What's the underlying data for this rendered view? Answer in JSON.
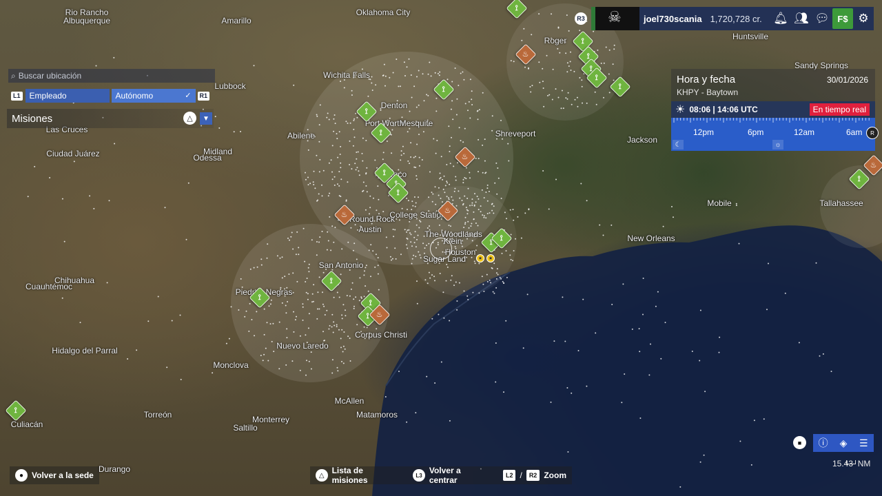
{
  "topbar": {
    "r3_badge": "R3",
    "username": "joel730scania",
    "credits": "1,720,728 cr.",
    "icons": [
      "bell-icon",
      "friends-icon",
      "chat-icon",
      "shop-icon",
      "gear-icon"
    ],
    "shop_label": "F$"
  },
  "search": {
    "placeholder": "Buscar ubicación"
  },
  "mode_tabs": {
    "left_badge": "L1",
    "right_badge": "R1",
    "employee": "Empleado",
    "freelance": "Autónomo",
    "selected": "Autónomo"
  },
  "missions": {
    "title": "Misiones"
  },
  "time_panel": {
    "title": "Hora y fecha",
    "date": "30/01/2026",
    "station": "KHPY - Baytown",
    "clock": "08:06 | 14:06 UTC",
    "realtime": "En tiempo real",
    "timeline_labels": [
      "12pm",
      "6pm",
      "12am",
      "6am"
    ],
    "r_badge": "R"
  },
  "cities": [
    "Rio Rancho",
    "Albuquerque",
    "Amarillo",
    "Oklahoma City",
    "Huntsville",
    "Sandy Springs",
    "Lubbock",
    "Wichita Falls",
    "Denton",
    "Fort Worth",
    "Mesquite",
    "Abilene",
    "Shreveport",
    "Jackson",
    "Las Cruces",
    "Ciudad Juárez",
    "Midland",
    "Odessa",
    "Waco",
    "Mobile",
    "Tallahassee",
    "Round Rock",
    "Austin",
    "College Station",
    "The Woodlands",
    "Klein",
    "Houston",
    "Sugar Land",
    "New Orleans",
    "San Antonio",
    "Chihuahua",
    "Cuauhtémoc",
    "Piedras Negras",
    "Corpus Christi",
    "Nuevo Laredo",
    "Hidalgo del Parral",
    "Monclova",
    "McAllen",
    "Culiacán",
    "Torreón",
    "Monterrey",
    "Matamoros",
    "Saltillo",
    "Durango",
    "Roger"
  ],
  "hints": {
    "back_to_base": "Volver a la sede",
    "mission_list": "Lista de misiones",
    "recenter_badge": "L3",
    "recenter": "Volver a centrar",
    "zoom_l2": "L2",
    "zoom_sep": "/",
    "zoom_r2": "R2",
    "zoom": "Zoom"
  },
  "scale": {
    "value": "15.43",
    "unit": "NM"
  },
  "colors": {
    "panel_blue": "#233155",
    "accent_blue": "#2a5dc9",
    "farm_green": "#6fb43f",
    "fire_orange": "#b9693a",
    "live_red": "#e0203d"
  }
}
